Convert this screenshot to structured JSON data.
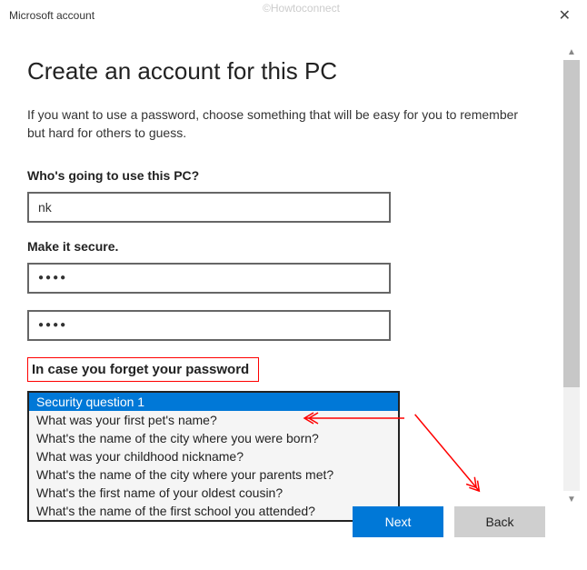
{
  "window": {
    "title": "Microsoft account",
    "watermark": "©Howtoconnect"
  },
  "page": {
    "heading": "Create an account for this PC",
    "description": "If you want to use a password, choose something that will be easy for you to remember but hard for others to guess.",
    "who_label": "Who's going to use this PC?",
    "username_value": "nk",
    "secure_label": "Make it secure.",
    "password_mask": "●●●●",
    "confirm_mask": "●●●●",
    "forgot_label": "In case you forget your password"
  },
  "dropdown": {
    "options": [
      "Security question 1",
      "What was your first pet's name?",
      "What's the name of the city where you were born?",
      "What was your childhood nickname?",
      "What's the name of the city where your parents met?",
      "What's the first name of your oldest cousin?",
      "What's the name of the first school you attended?"
    ],
    "selected_index": 0
  },
  "buttons": {
    "next": "Next",
    "back": "Back"
  },
  "colors": {
    "accent": "#0078d7",
    "annotation": "#ff0000"
  }
}
